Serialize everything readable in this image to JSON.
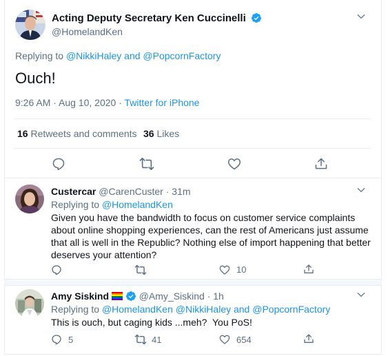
{
  "main_tweet": {
    "display_name": "Acting Deputy Secretary Ken Cuccinelli",
    "handle": "@HomelandKen",
    "replying_prefix": "Replying to",
    "replying_to": "@NikkiHaley and @PopcornFactory",
    "text": "Ouch!",
    "time": "9:26 AM · Aug 10, 2020 · ",
    "source": "Twitter for iPhone",
    "retweets_count": "16",
    "retweets_label": "Retweets and comments",
    "likes_count": "36",
    "likes_label": "Likes",
    "icons": [
      "reply-icon",
      "retweet-icon",
      "like-icon",
      "share-icon"
    ]
  },
  "replies": [
    {
      "display_name": "Custercar",
      "meta": "@CarenCuster · 31m",
      "replying_prefix": "Replying to",
      "replying_to": "@HomelandKen",
      "text_lines": [
        "Given you have the bandwidth to focus on customer service complaints",
        "about online shopping experiences, can the rest of Americans just assume",
        "that all is well in the Republic? Nothing else of import happening that better",
        "deserves your attention?"
      ],
      "reply_count": "",
      "retweet_count": "",
      "like_count": "10"
    },
    {
      "display_name": "Amy Siskind",
      "meta": "@Amy_Siskind · 1h",
      "replying_prefix": "Replying to",
      "replying_to": "@HomelandKen @NikkiHaley and @PopcornFactory",
      "text": "This is ouch, but caging kids ...meh?  You PoS!",
      "reply_count": "5",
      "retweet_count": "41",
      "like_count": "654"
    }
  ],
  "colors": {
    "accent": "#1b95e0",
    "secondary_text": "#5b7083",
    "border": "#e6ecf0"
  }
}
